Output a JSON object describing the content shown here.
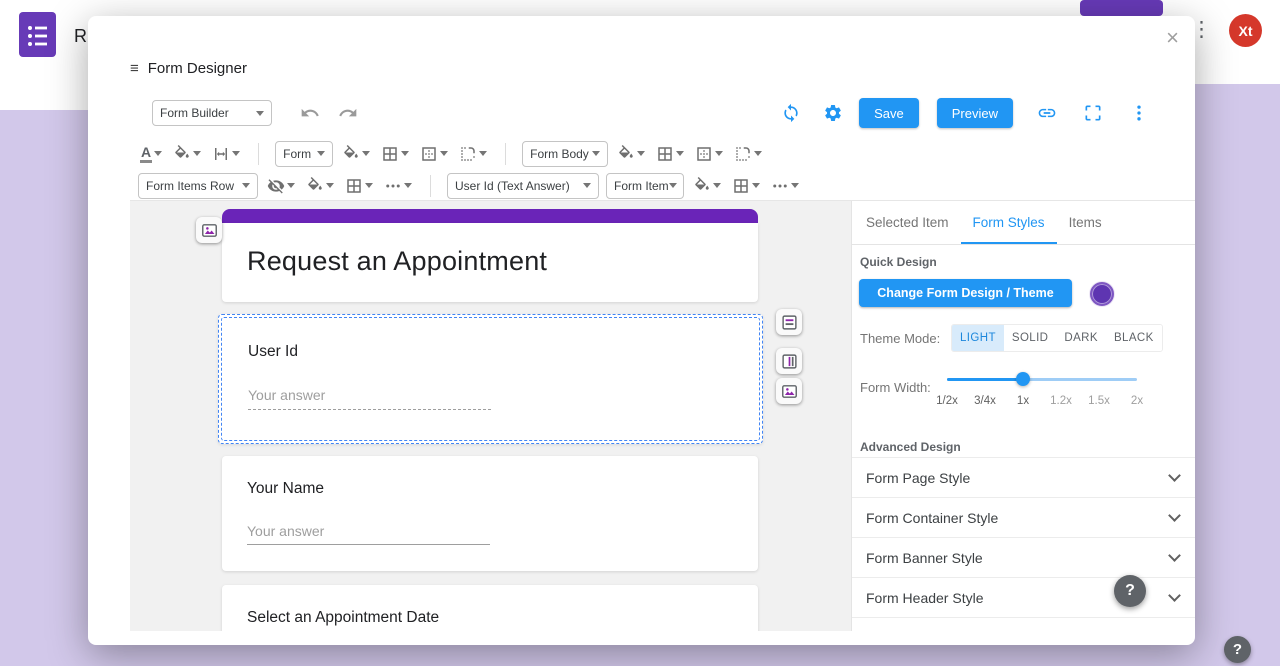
{
  "chrome": {
    "app_letter": "R",
    "avatar": "Xt",
    "help": "?"
  },
  "icons": {
    "menu": "≡",
    "close": "×",
    "kebab": "⋮",
    "text_color": "A"
  },
  "modal": {
    "title": "Form Designer"
  },
  "toolbar_main": {
    "builder_select": "Form Builder",
    "save": "Save",
    "preview": "Preview"
  },
  "toolbar_style": {
    "form_select": "Form",
    "form_body_select": "Form Body"
  },
  "toolbar_items": {
    "row_select": "Form Items Row",
    "item_select": "User Id (Text Answer)",
    "form_item_select": "Form Item"
  },
  "form_preview": {
    "title": "Request an Appointment",
    "fields": [
      {
        "label": "User Id",
        "placeholder": "Your answer"
      },
      {
        "label": "Your Name",
        "placeholder": "Your answer"
      },
      {
        "label": "Select an Appointment Date"
      }
    ]
  },
  "panel": {
    "tabs": [
      {
        "label": "Selected Item"
      },
      {
        "label": "Form Styles"
      },
      {
        "label": "Items"
      }
    ],
    "active_tab": "Form Styles",
    "quick_design_label": "Quick Design",
    "change_theme_button": "Change Form Design / Theme",
    "theme_mode_label": "Theme Mode:",
    "theme_modes": [
      {
        "label": "LIGHT"
      },
      {
        "label": "SOLID"
      },
      {
        "label": "DARK"
      },
      {
        "label": "BLACK"
      }
    ],
    "selected_theme_mode": "LIGHT",
    "form_width_label": "Form Width:",
    "width_ticks": [
      "1/2x",
      "3/4x",
      "1x",
      "1.2x",
      "1.5x",
      "2x"
    ],
    "form_width_value": "1x",
    "advanced_design_label": "Advanced Design",
    "sections": [
      {
        "label": "Form Page Style"
      },
      {
        "label": "Form Container Style"
      },
      {
        "label": "Form Banner Style"
      },
      {
        "label": "Form Header Style"
      }
    ]
  },
  "colors": {
    "accent_blue": "#2196f3",
    "banner_purple": "#6a24b8",
    "theme_swatch_purple": "#5e35b1",
    "avatar_red": "#d5382b",
    "page_background": "#d2c8ea",
    "selection_blue": "#4285f4"
  }
}
